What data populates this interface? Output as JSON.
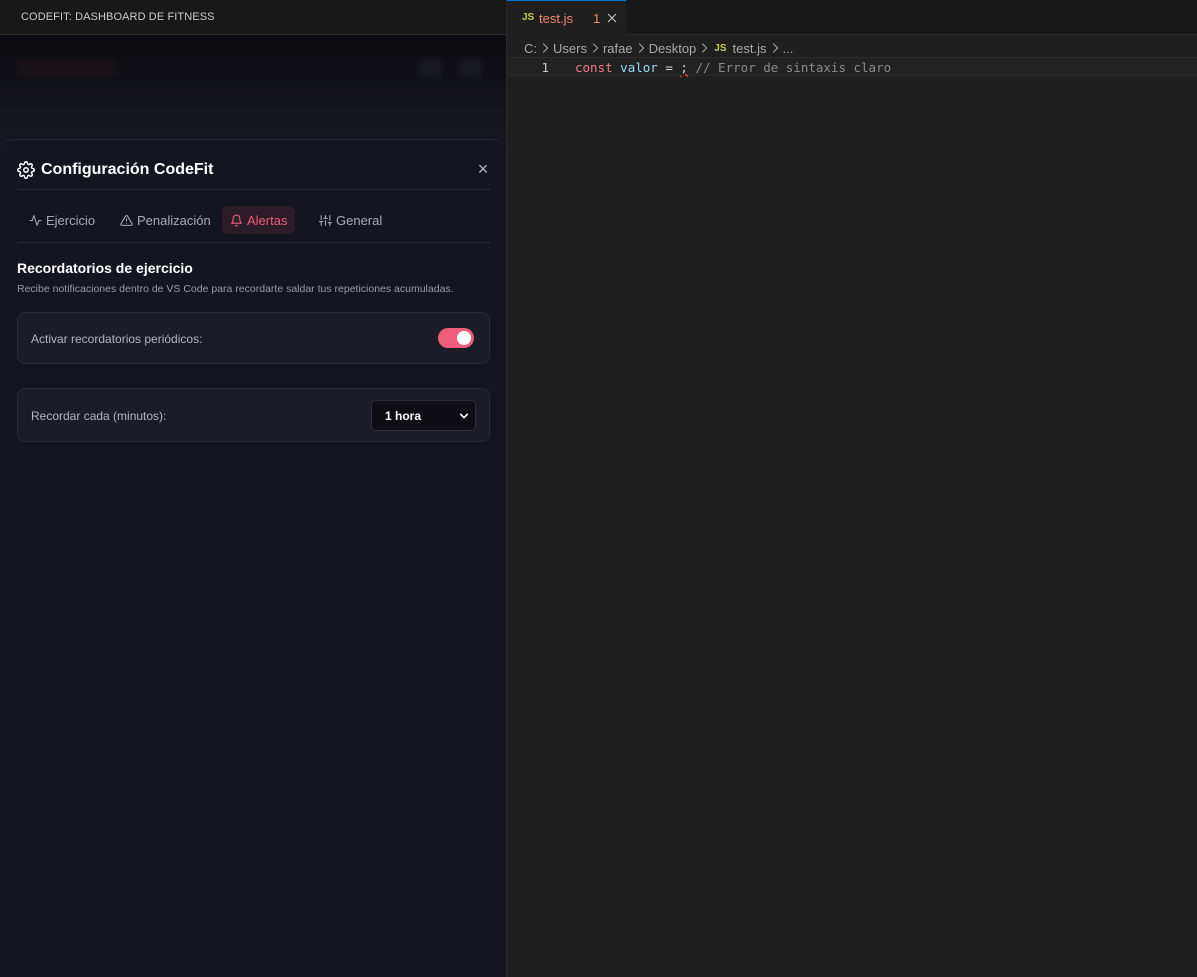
{
  "webview": {
    "title": "CODEFIT: DASHBOARD DE FITNESS"
  },
  "settings": {
    "title": "Configuración CodeFit",
    "close_label": "×",
    "tabs": [
      {
        "label": "Ejercicio",
        "icon": "activity-icon",
        "active": false
      },
      {
        "label": "Penalización",
        "icon": "warning-icon",
        "active": false
      },
      {
        "label": "Alertas",
        "icon": "bell-icon",
        "active": true
      },
      {
        "label": "General",
        "icon": "sliders-icon",
        "active": false
      }
    ],
    "section_title": "Recordatorios de ejercicio",
    "section_desc": "Recibe notificaciones dentro de VS Code para recordarte saldar tus repeticiones acumuladas.",
    "reminders_label": "Activar recordatorios periódicos:",
    "reminders_enabled": true,
    "interval_label": "Recordar cada (minutos):",
    "interval_value": "1 hora",
    "accent_color": "#ef5d7b"
  },
  "editor": {
    "tab": {
      "badge": "JS",
      "name": "test.js",
      "problems": "1"
    },
    "breadcrumb": [
      "C:",
      "Users",
      "rafae",
      "Desktop",
      "test.js",
      "..."
    ],
    "lines": [
      {
        "number": "1",
        "tokens": {
          "keyword": "const",
          "variable": "valor",
          "operator": "=",
          "error": ";",
          "comment": "// Error de sintaxis claro"
        }
      }
    ]
  }
}
